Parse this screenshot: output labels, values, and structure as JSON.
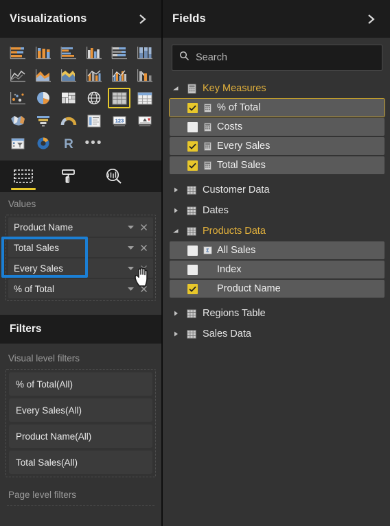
{
  "visualizations": {
    "title": "Visualizations",
    "collapse_icon": "chevron-right-icon",
    "palette": {
      "rows": [
        [
          {
            "name": "stacked-bar-chart-icon",
            "selected": false
          },
          {
            "name": "stacked-column-chart-icon",
            "selected": false
          },
          {
            "name": "clustered-bar-chart-icon",
            "selected": false
          },
          {
            "name": "clustered-column-chart-icon",
            "selected": false
          },
          {
            "name": "100-percent-stacked-bar-chart-icon",
            "selected": false
          },
          {
            "name": "100-percent-stacked-column-chart-icon",
            "selected": false
          }
        ],
        [
          {
            "name": "line-chart-icon",
            "selected": false
          },
          {
            "name": "area-chart-icon",
            "selected": false
          },
          {
            "name": "stacked-area-chart-icon",
            "selected": false
          },
          {
            "name": "line-and-stacked-column-chart-icon",
            "selected": false
          },
          {
            "name": "line-and-clustered-column-chart-icon",
            "selected": false
          },
          {
            "name": "ribbon-chart-icon",
            "selected": false
          }
        ],
        [
          {
            "name": "scatter-chart-icon",
            "selected": false
          },
          {
            "name": "pie-chart-icon",
            "selected": false
          },
          {
            "name": "treemap-icon",
            "selected": false
          },
          {
            "name": "map-icon",
            "selected": false
          },
          {
            "name": "table-icon",
            "selected": true
          },
          {
            "name": "matrix-icon",
            "selected": false
          }
        ],
        [
          {
            "name": "filled-map-icon",
            "selected": false
          },
          {
            "name": "funnel-chart-icon",
            "selected": false
          },
          {
            "name": "gauge-chart-icon",
            "selected": false
          },
          {
            "name": "multi-row-card-icon",
            "selected": false
          },
          {
            "name": "card-icon",
            "selected": false
          },
          {
            "name": "kpi-icon",
            "selected": false
          }
        ],
        [
          {
            "name": "slicer-icon",
            "selected": false
          },
          {
            "name": "donut-chart-icon",
            "selected": false
          },
          {
            "name": "r-script-visual-icon",
            "selected": false
          },
          {
            "name": "more-options-icon",
            "selected": false
          }
        ]
      ]
    },
    "tabs": [
      {
        "name": "fields-tab",
        "icon": "fields-grid-icon",
        "active": true
      },
      {
        "name": "format-tab",
        "icon": "paint-roller-icon",
        "active": false
      },
      {
        "name": "analytics-tab",
        "icon": "analytics-magnifier-icon",
        "active": false
      }
    ],
    "values_well": {
      "label": "Values",
      "fields": [
        {
          "name": "Product Name",
          "highlighted": false
        },
        {
          "name": "Total Sales",
          "highlighted": true
        },
        {
          "name": "Every Sales",
          "highlighted": true
        },
        {
          "name": "% of Total",
          "highlighted": false
        }
      ],
      "caret_icon": "caret-down-icon",
      "remove_icon": "remove-x-icon"
    },
    "highlight_color": "#1b7fd4",
    "accent_color": "#e8c92b"
  },
  "filters": {
    "title": "Filters",
    "visual_level_label": "Visual level filters",
    "visual_level_items": [
      "% of Total(All)",
      "Every Sales(All)",
      "Product Name(All)",
      "Total Sales(All)"
    ],
    "page_level_label": "Page level filters"
  },
  "fields": {
    "title": "Fields",
    "collapse_icon": "chevron-right-icon",
    "search": {
      "placeholder": "Search",
      "value": "",
      "icon": "search-icon"
    },
    "tree": [
      {
        "label": "Key Measures",
        "type": "group",
        "expanded": true,
        "icon": "measure-table-icon",
        "children": [
          {
            "label": "% of Total",
            "checked": true,
            "selected": true,
            "icon": "measure-icon"
          },
          {
            "label": "Costs",
            "checked": false,
            "selected": false,
            "icon": "measure-icon"
          },
          {
            "label": "Every Sales",
            "checked": true,
            "selected": false,
            "icon": "measure-icon"
          },
          {
            "label": "Total Sales",
            "checked": true,
            "selected": false,
            "icon": "measure-icon"
          }
        ]
      },
      {
        "label": "Customer Data",
        "type": "table",
        "expanded": false,
        "icon": "table-grid-icon",
        "children": []
      },
      {
        "label": "Dates",
        "type": "table",
        "expanded": false,
        "icon": "table-grid-icon",
        "children": []
      },
      {
        "label": "Products Data",
        "type": "table",
        "expanded": true,
        "icon": "table-grid-icon",
        "children": [
          {
            "label": "All Sales",
            "checked": false,
            "selected": false,
            "icon": "summarized-field-icon"
          },
          {
            "label": "Index",
            "checked": false,
            "selected": false,
            "icon": "none"
          },
          {
            "label": "Product Name",
            "checked": true,
            "selected": false,
            "icon": "none"
          }
        ]
      },
      {
        "label": "Regions Table",
        "type": "table",
        "expanded": false,
        "icon": "table-grid-icon",
        "children": []
      },
      {
        "label": "Sales Data",
        "type": "table",
        "expanded": false,
        "icon": "table-grid-icon",
        "children": []
      }
    ]
  },
  "cursor": {
    "icon": "hand-pointer-cursor"
  }
}
